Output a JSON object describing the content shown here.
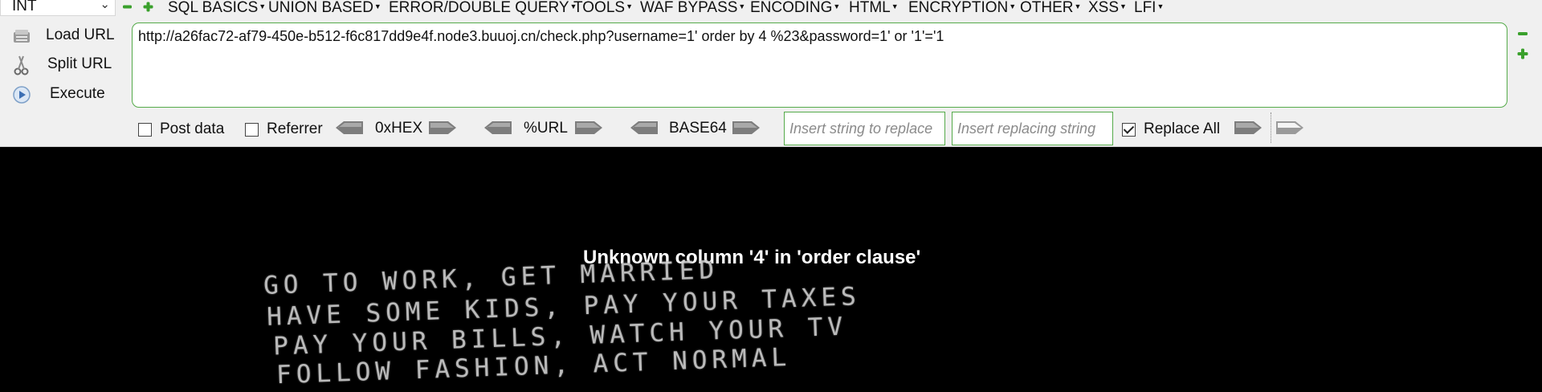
{
  "hackbar": {
    "type_select": "INT",
    "menu": [
      {
        "label": "SQL BASICS",
        "dropdown": true
      },
      {
        "label": "UNION BASED",
        "dropdown": true
      },
      {
        "label": "ERROR/DOUBLE QUERY",
        "dropdown": true
      },
      {
        "label": "TOOLS",
        "dropdown": true
      },
      {
        "label": "WAF BYPASS",
        "dropdown": true
      },
      {
        "label": "ENCODING",
        "dropdown": true
      },
      {
        "label": "HTML",
        "dropdown": true
      },
      {
        "label": "ENCRYPTION",
        "dropdown": true
      },
      {
        "label": "OTHER",
        "dropdown": true
      },
      {
        "label": "XSS",
        "dropdown": true
      },
      {
        "label": "LFI",
        "dropdown": true
      }
    ],
    "actions": {
      "load_url": "Load URL",
      "split_url": "Split URL",
      "execute": "Execute"
    },
    "url": "http://a26fac72-af79-450e-b512-f6c817dd9e4f.node3.buuoj.cn/check.php?username=1' order by 4 %23&password=1' or '1'='1",
    "post_data": {
      "label": "Post data",
      "checked": false
    },
    "referrer": {
      "label": "Referrer",
      "checked": false
    },
    "encoders": {
      "hex": "0xHEX",
      "url": "%URL",
      "base64": "BASE64"
    },
    "replace": {
      "find_placeholder": "Insert string to replace",
      "with_placeholder": "Insert replacing string",
      "replace_all_label": "Replace All",
      "replace_all_checked": true
    },
    "colors": {
      "accent_green": "#55aa4a",
      "icon_green": "#3aa02c"
    },
    "icons": [
      "minus-icon",
      "plus-icon",
      "load-url-icon",
      "split-url-icon",
      "execute-icon",
      "left-arrow-icon",
      "right-arrow-icon"
    ]
  },
  "page": {
    "error_message": "Unknown column '4' in 'order clause'",
    "background_image_text": [
      "GO TO WORK, GET MARRIED",
      "HAVE SOME KIDS, PAY YOUR TAXES",
      "PAY YOUR BILLS, WATCH YOUR TV",
      "FOLLOW FASHION, ACT NORMAL"
    ]
  }
}
